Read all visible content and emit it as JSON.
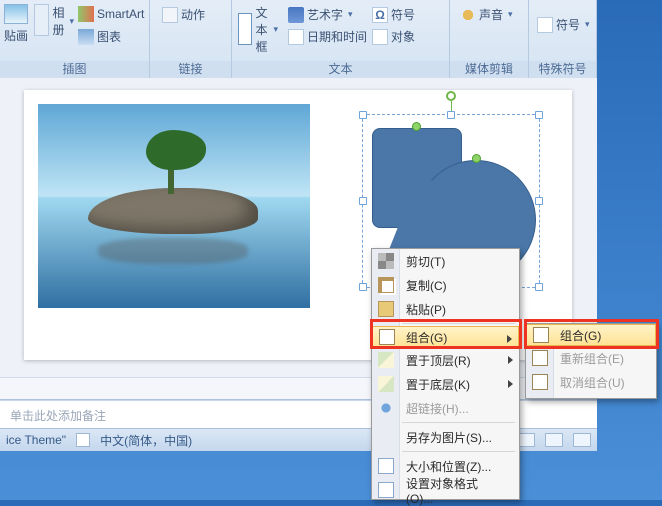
{
  "ribbon": {
    "groups": {
      "illust": {
        "title": "插图",
        "paste": "贴画",
        "album": "相册",
        "smartart": "SmartArt",
        "chart": "图表"
      },
      "link": {
        "title": "链接",
        "action": "动作"
      },
      "text": {
        "title": "文本",
        "textbox": "文本框",
        "wordart": "艺术字",
        "datetime": "日期和时间",
        "symbol": "符号",
        "object": "对象"
      },
      "media": {
        "title": "媒体剪辑",
        "sound": "声音"
      },
      "special": {
        "title": "特殊符号",
        "symbol": "符号"
      }
    }
  },
  "notes_placeholder": "单击此处添加备注",
  "status": {
    "theme": "ice Theme\"",
    "lang": "中文(简体，中国)"
  },
  "menu1": {
    "cut": "剪切(T)",
    "copy": "复制(C)",
    "paste": "粘贴(P)",
    "group": "组合(G)",
    "bringfront": "置于顶层(R)",
    "sendback": "置于底层(K)",
    "hyperlink": "超链接(H)...",
    "savepic": "另存为图片(S)...",
    "sizepos": "大小和位置(Z)...",
    "format": "设置对象格式(O)..."
  },
  "menu2": {
    "group": "组合(G)",
    "regroup": "重新组合(E)",
    "ungroup": "取消组合(U)"
  }
}
